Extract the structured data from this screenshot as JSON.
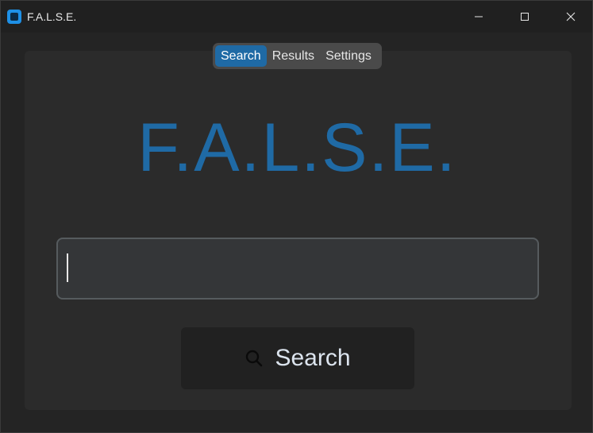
{
  "window": {
    "title": "F.A.L.S.E."
  },
  "tabs": [
    {
      "label": "Search",
      "active": true
    },
    {
      "label": "Results",
      "active": false
    },
    {
      "label": "Settings",
      "active": false
    }
  ],
  "main": {
    "heading": "F.A.L.S.E.",
    "search_value": "",
    "search_placeholder": "",
    "search_button_label": "Search"
  },
  "colors": {
    "accent": "#1f6aa5",
    "background": "#242424",
    "panel": "#2b2b2b",
    "input_bg": "#343638",
    "button_bg": "#212121"
  },
  "icons": {
    "app": "app-icon",
    "minimize": "minimize-icon",
    "maximize": "maximize-icon",
    "close": "close-icon",
    "search": "search-icon"
  }
}
